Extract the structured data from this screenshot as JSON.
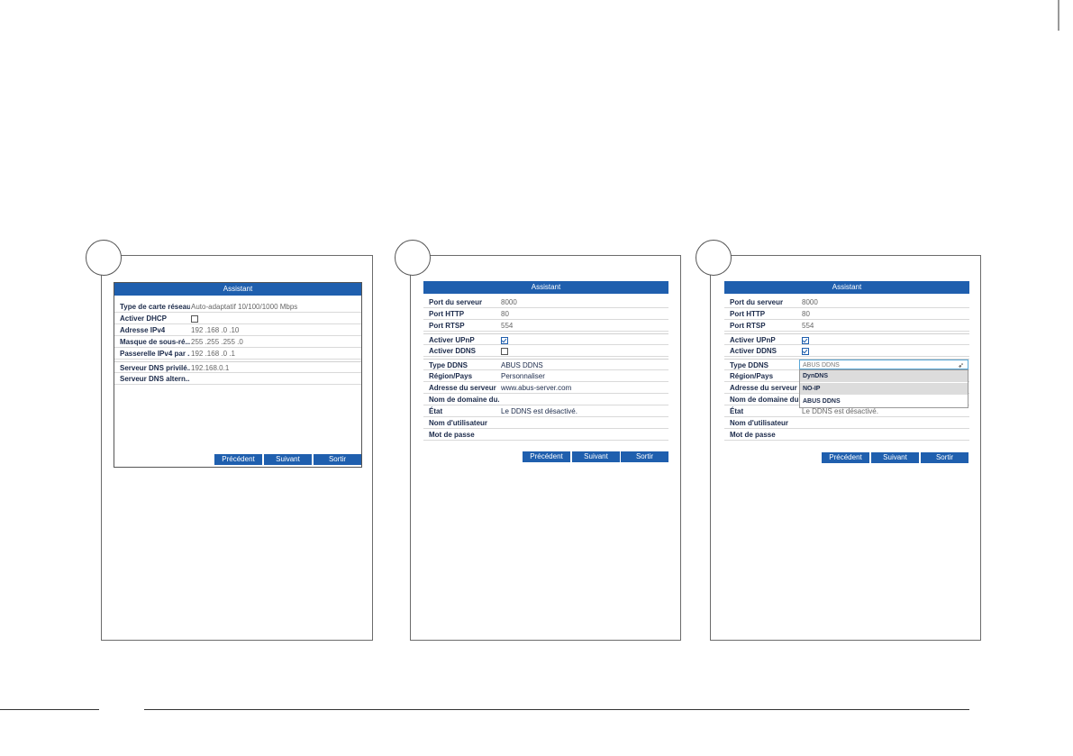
{
  "panel1": {
    "title": "Assistant",
    "rows": [
      {
        "label": "Type de carte réseau",
        "value": "Auto-adaptatif 10/100/1000 Mbps"
      },
      {
        "label": "Activer DHCP",
        "checkbox": false
      },
      {
        "label": "Adresse IPv4",
        "value": "192 .168 .0    .10"
      },
      {
        "label": "Masque de sous-ré...",
        "value": "255 .255 .255 .0"
      },
      {
        "label": "Passerelle IPv4 par ...",
        "value": "192 .168 .0    .1"
      },
      {
        "label": "Serveur DNS privilé...",
        "value": "192.168.0.1"
      },
      {
        "label": "Serveur DNS altern...",
        "value": ""
      }
    ],
    "buttons": {
      "prev": "Précédent",
      "next": "Suivant",
      "exit": "Sortir"
    }
  },
  "panel2": {
    "title": "Assistant",
    "rows": [
      {
        "label": "Port du serveur",
        "value": "8000"
      },
      {
        "label": "Port HTTP",
        "value": "80"
      },
      {
        "label": "Port RTSP",
        "value": "554"
      },
      {
        "label": "Activer UPnP",
        "checkbox": true
      },
      {
        "label": "Activer DDNS",
        "checkbox": false
      },
      {
        "label": "Type DDNS",
        "value": "ABUS DDNS"
      },
      {
        "label": "Région/Pays",
        "value": "Personnaliser"
      },
      {
        "label": "Adresse du serveur",
        "value": "www.abus-server.com"
      },
      {
        "label": "Nom de domaine du...",
        "value": ""
      },
      {
        "label": "État",
        "value": "Le DDNS est désactivé."
      },
      {
        "label": "Nom d'utilisateur",
        "value": ""
      },
      {
        "label": "Mot de passe",
        "value": ""
      }
    ],
    "buttons": {
      "prev": "Précédent",
      "next": "Suivant",
      "exit": "Sortir"
    }
  },
  "panel3": {
    "title": "Assistant",
    "rows": [
      {
        "label": "Port du serveur",
        "value": "8000"
      },
      {
        "label": "Port HTTP",
        "value": "80"
      },
      {
        "label": "Port RTSP",
        "value": "554"
      },
      {
        "label": "Activer UPnP",
        "checkbox": true
      },
      {
        "label": "Activer DDNS",
        "checkbox": true
      },
      {
        "label": "Type DDNS",
        "value": ""
      },
      {
        "label": "Région/Pays",
        "value": ""
      },
      {
        "label": "Adresse du serveur",
        "value": ""
      },
      {
        "label": "Nom de domaine du...",
        "value": ""
      },
      {
        "label": "État",
        "value": "Le DDNS est désactivé."
      },
      {
        "label": "Nom d'utilisateur",
        "value": ""
      },
      {
        "label": "Mot de passe",
        "value": ""
      }
    ],
    "dropdown": {
      "selected": "ABUS DDNS",
      "options": [
        "DynDNS",
        "NO-IP",
        "ABUS DDNS"
      ]
    },
    "buttons": {
      "prev": "Précédent",
      "next": "Suivant",
      "exit": "Sortir"
    }
  },
  "colors": {
    "accent": "#1f5fae",
    "focus_border": "#5aa7d6"
  }
}
